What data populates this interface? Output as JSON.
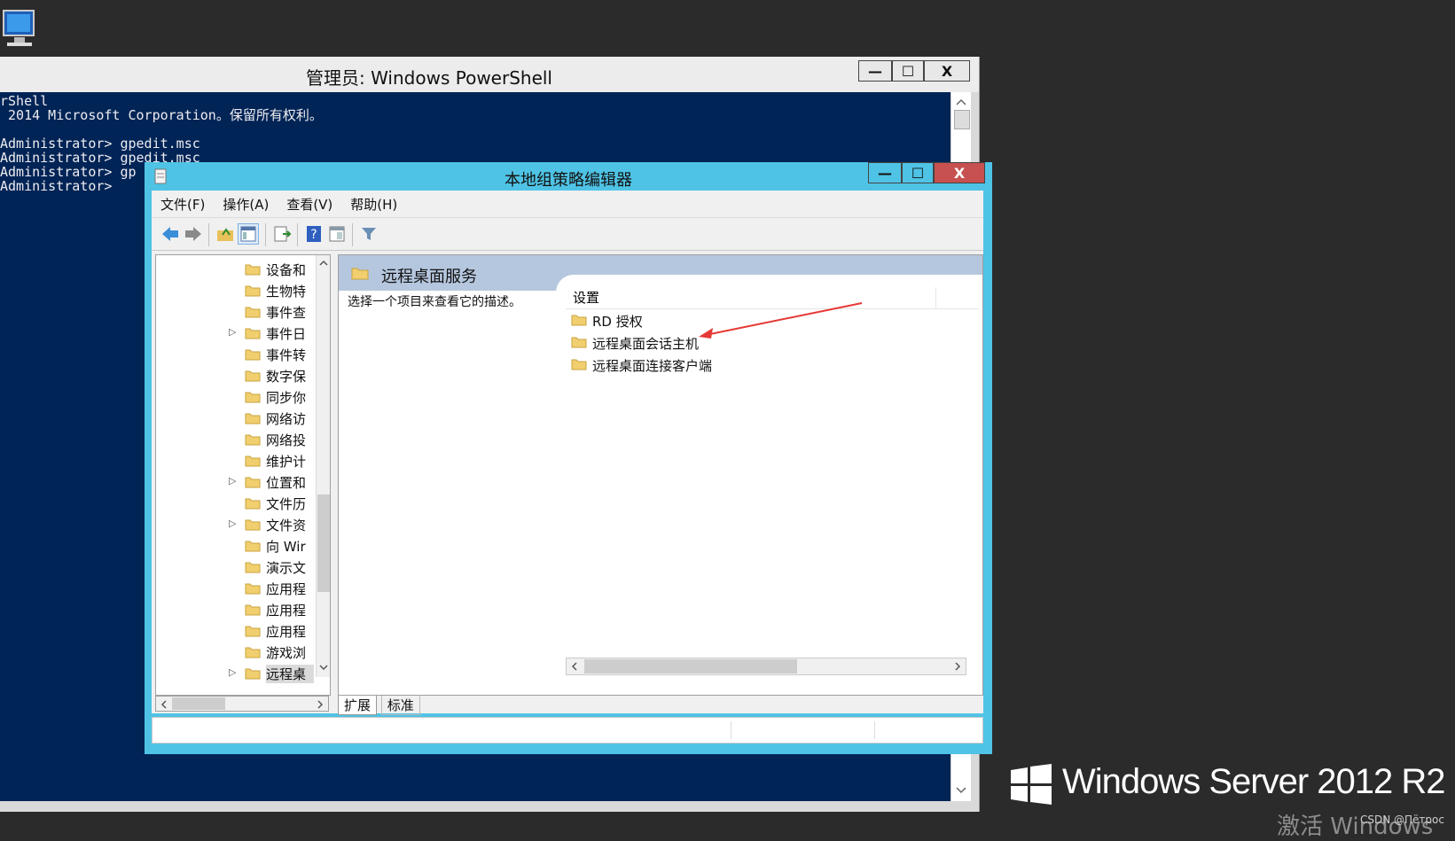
{
  "powershell": {
    "title": "管理员: Windows PowerShell",
    "lines": [
      "rShell",
      " 2014 Microsoft Corporation。保留所有权利。",
      "",
      "Administrator> gpedit.msc",
      "Administrator> gpedit.msc",
      "Administrator> gp",
      "Administrator>"
    ],
    "minimize": "—",
    "maximize": "☐",
    "close": "X"
  },
  "gpedit": {
    "title": "本地组策略编辑器",
    "menu": [
      "文件(F)",
      "操作(A)",
      "查看(V)",
      "帮助(H)"
    ],
    "tree_items": [
      {
        "label": "设备和",
        "expandable": false
      },
      {
        "label": "生物特",
        "expandable": false
      },
      {
        "label": "事件查",
        "expandable": false
      },
      {
        "label": "事件日",
        "expandable": true
      },
      {
        "label": "事件转",
        "expandable": false
      },
      {
        "label": "数字保",
        "expandable": false
      },
      {
        "label": "同步你",
        "expandable": false
      },
      {
        "label": "网络访",
        "expandable": false
      },
      {
        "label": "网络投",
        "expandable": false
      },
      {
        "label": "维护计",
        "expandable": false
      },
      {
        "label": "位置和",
        "expandable": true
      },
      {
        "label": "文件历",
        "expandable": false
      },
      {
        "label": "文件资",
        "expandable": true
      },
      {
        "label": "向 Wir",
        "expandable": false
      },
      {
        "label": "演示文",
        "expandable": false
      },
      {
        "label": "应用程",
        "expandable": false
      },
      {
        "label": "应用程",
        "expandable": false
      },
      {
        "label": "应用程",
        "expandable": false
      },
      {
        "label": "游戏浏",
        "expandable": false
      },
      {
        "label": "远程桌",
        "expandable": true,
        "selected": true
      }
    ],
    "right_header": "远程桌面服务",
    "description": "选择一个项目来查看它的描述。",
    "column_header": "设置",
    "items": [
      "RD 授权",
      "远程桌面会话主机",
      "远程桌面连接客户端"
    ],
    "tabs": [
      "扩展",
      "标准"
    ],
    "minimize": "—",
    "maximize": "☐",
    "close": "X"
  },
  "desktop": {
    "watermark": "Windows Server 2012 R2",
    "activate": "激活 Windows",
    "csdn": "CSDN @Пётрос"
  },
  "colors": {
    "console_bg": "#012456",
    "gp_frame": "#4fc3e5",
    "close_red": "#c75050",
    "annotation_arrow": "#e53935"
  }
}
